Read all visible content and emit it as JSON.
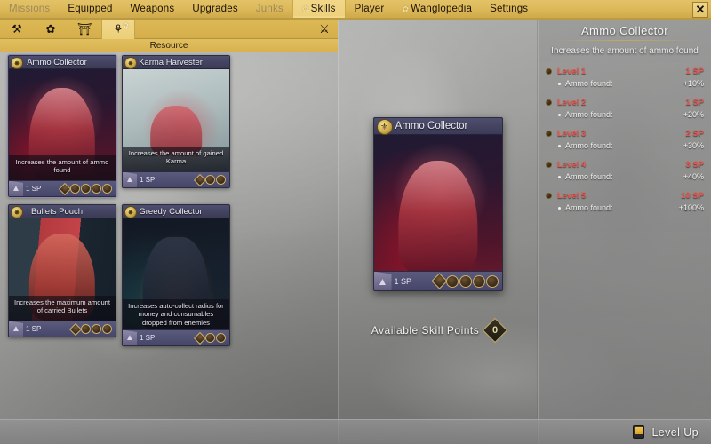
{
  "colors": {
    "nav_bg": "#dcb858",
    "nav_active": "#f2d789",
    "accent_gold": "#c5a85f",
    "level_red": "#e8564e",
    "card_header": "#3b3b57"
  },
  "topnav": {
    "items": [
      {
        "label": "Missions",
        "icon": null,
        "active": false,
        "dim": true
      },
      {
        "label": "Equipped",
        "icon": null,
        "active": false,
        "dim": false
      },
      {
        "label": "Weapons",
        "icon": null,
        "active": false,
        "dim": false
      },
      {
        "label": "Upgrades",
        "icon": null,
        "active": false,
        "dim": false
      },
      {
        "label": "Junks",
        "icon": null,
        "active": false,
        "dim": true
      },
      {
        "label": "Skills",
        "icon": "flower-icon",
        "active": true,
        "dim": false
      },
      {
        "label": "Player",
        "icon": null,
        "active": false,
        "dim": false
      },
      {
        "label": "Wanglopedia",
        "icon": "flower-icon",
        "active": false,
        "dim": false
      },
      {
        "label": "Settings",
        "icon": null,
        "active": false,
        "dim": false
      }
    ],
    "close_label": "✕"
  },
  "category_bar": {
    "tabs": [
      {
        "name": "combat-tree-icon",
        "glyph": "⚒",
        "active": false
      },
      {
        "name": "mobility-tree-icon",
        "glyph": "✿",
        "active": false
      },
      {
        "name": "torii-tree-icon",
        "glyph": "⛩",
        "active": false
      },
      {
        "name": "resource-tree-icon",
        "glyph": "⚘",
        "active": true
      }
    ],
    "reset_icon": "⚔",
    "subtitle": "Resource"
  },
  "skill_cards": [
    {
      "title": "Ammo Collector",
      "description": "Increases the amount of ammo found",
      "cost": "1 SP",
      "pips": 5,
      "art": "art-ammo",
      "selected": true
    },
    {
      "title": "Karma Harvester",
      "description": "Increases the amount of gained Karma",
      "cost": "1 SP",
      "pips": 3,
      "art": "art-karma",
      "selected": false
    },
    {
      "title": "Bullets Pouch",
      "description": "Increases the maximum amount of carried Bullets",
      "cost": "1 SP",
      "pips": 4,
      "art": "art-bullets",
      "selected": false
    },
    {
      "title": "Greedy Collector",
      "description": "Increases auto-collect radius for money and consumables dropped from enemies",
      "cost": "1 SP",
      "pips": 3,
      "art": "art-greedy",
      "selected": false
    }
  ],
  "preview": {
    "title": "Ammo Collector",
    "cost": "1 SP",
    "pips": 5,
    "skill_points_label": "Available Skill Points",
    "skill_points_value": "0"
  },
  "detail": {
    "title": "Ammo Collector",
    "subtitle": "Increases the amount of ammo found",
    "levels": [
      {
        "name": "Level 1",
        "cost": "1 SP",
        "effect": "Ammo found:",
        "value": "+10%"
      },
      {
        "name": "Level 2",
        "cost": "1 SP",
        "effect": "Ammo found:",
        "value": "+20%"
      },
      {
        "name": "Level 3",
        "cost": "2 SP",
        "effect": "Ammo found:",
        "value": "+30%"
      },
      {
        "name": "Level 4",
        "cost": "3 SP",
        "effect": "Ammo found:",
        "value": "+40%"
      },
      {
        "name": "Level 5",
        "cost": "10 SP",
        "effect": "Ammo found:",
        "value": "+100%"
      }
    ]
  },
  "bottombar": {
    "key_icon": "keyboard-key-icon",
    "levelup_label": "Level Up"
  }
}
